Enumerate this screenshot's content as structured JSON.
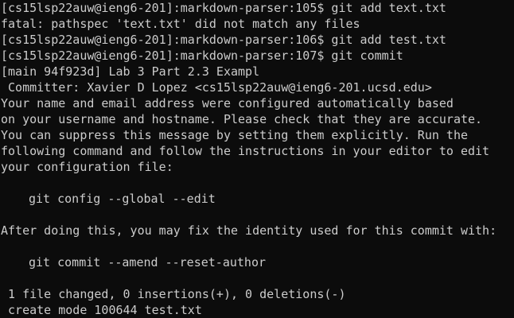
{
  "terminal": {
    "background": "#0c0c0c",
    "foreground": "#cccccc",
    "lines": [
      "[cs15lsp22auw@ieng6-201]:markdown-parser:105$ git add text.txt",
      "fatal: pathspec 'text.txt' did not match any files",
      "[cs15lsp22auw@ieng6-201]:markdown-parser:106$ git add test.txt",
      "[cs15lsp22auw@ieng6-201]:markdown-parser:107$ git commit",
      "[main 94f923d] Lab 3 Part 2.3 Exampl",
      " Committer: Xavier D Lopez <cs15lsp22auw@ieng6-201.ucsd.edu>",
      "Your name and email address were configured automatically based",
      "on your username and hostname. Please check that they are accurate.",
      "You can suppress this message by setting them explicitly. Run the",
      "following command and follow the instructions in your editor to edit",
      "your configuration file:",
      "",
      "git config --global --edit",
      "",
      "After doing this, you may fix the identity used for this commit with:",
      "",
      "git commit --amend --reset-author",
      "",
      " 1 file changed, 0 insertions(+), 0 deletions(-)",
      " create mode 100644 test.txt"
    ]
  }
}
